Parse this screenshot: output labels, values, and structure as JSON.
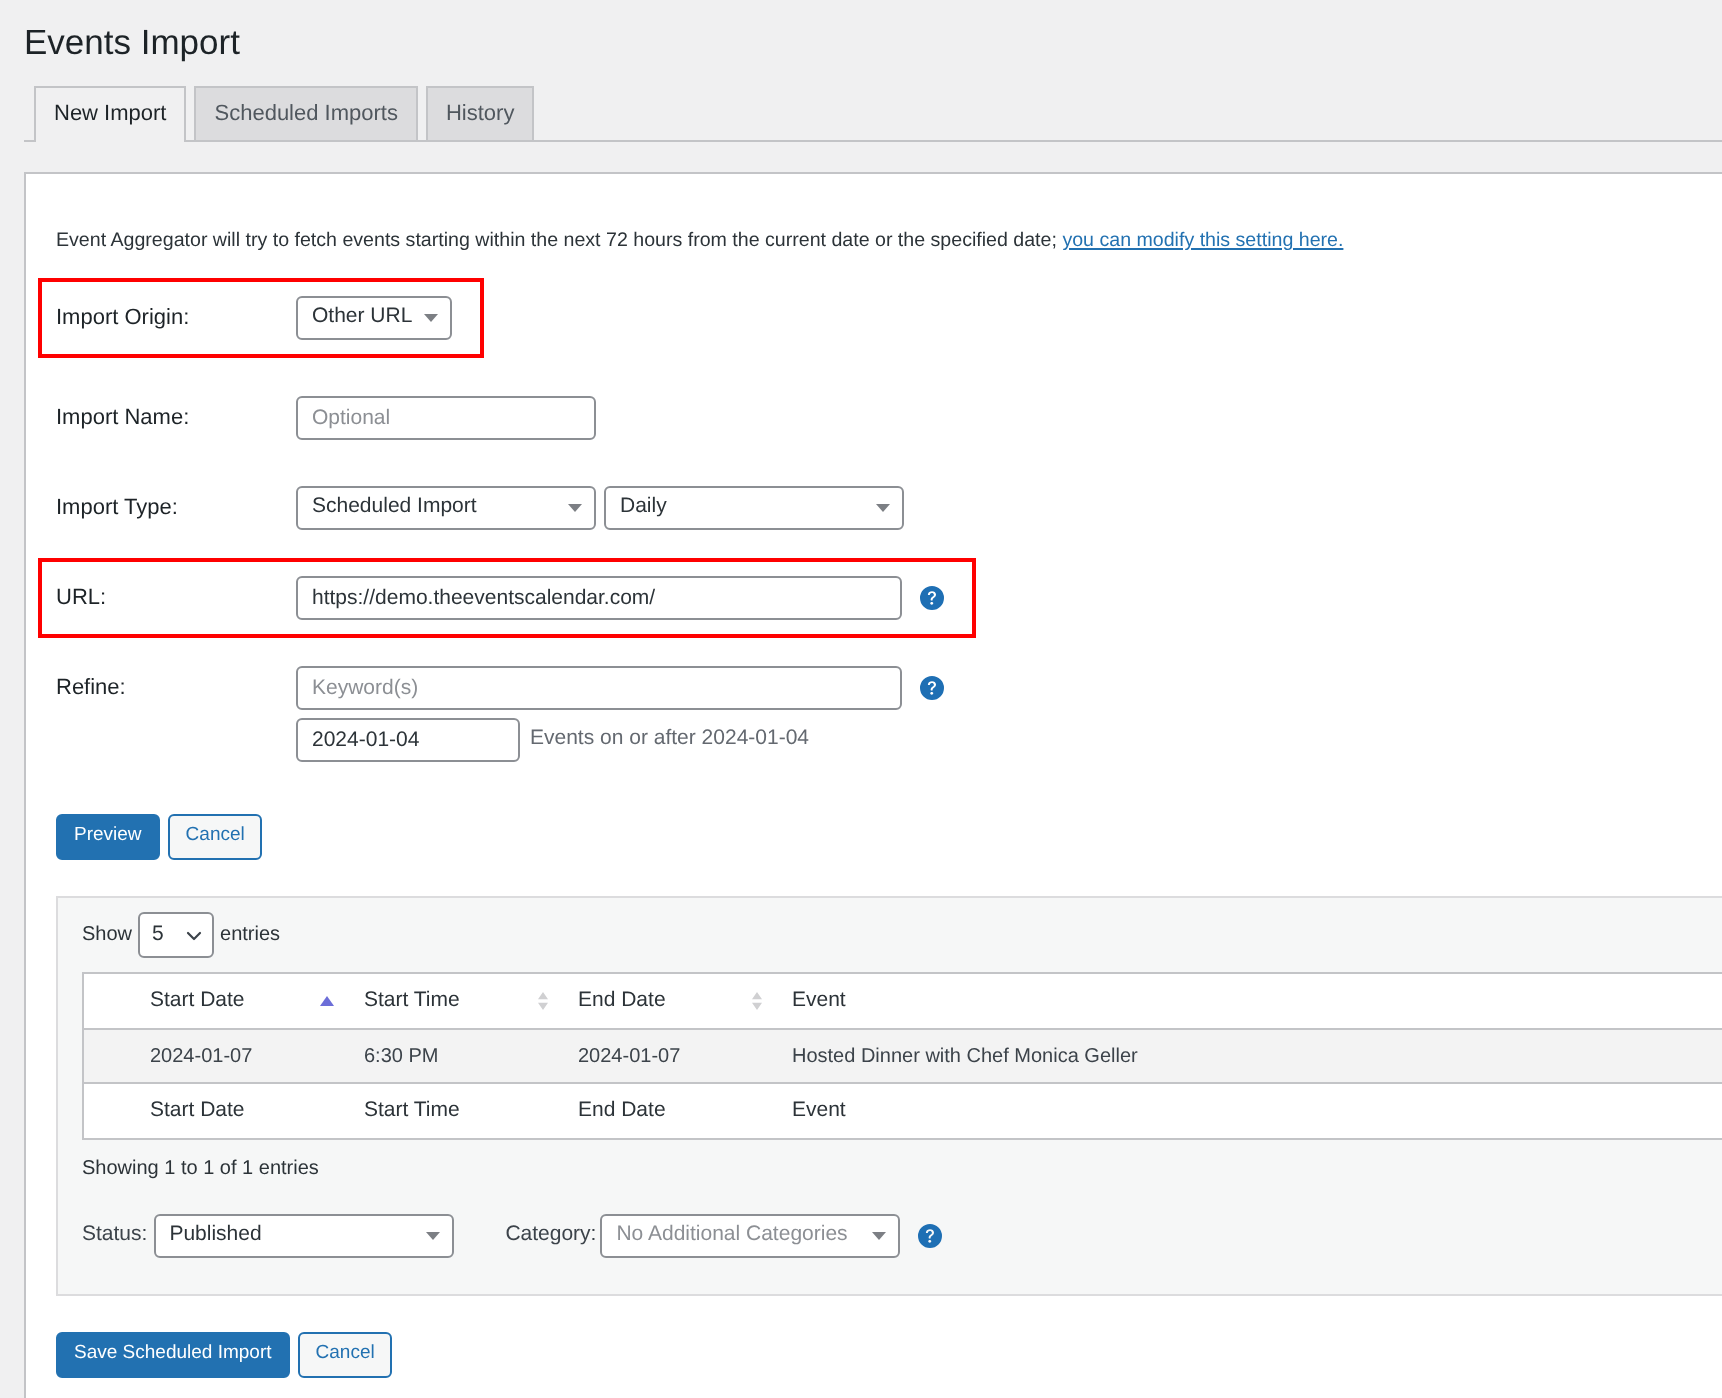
{
  "page": {
    "title": "Events Import"
  },
  "tabs": [
    {
      "label": "New Import",
      "selected": true
    },
    {
      "label": "Scheduled Imports",
      "selected": false
    },
    {
      "label": "History",
      "selected": false
    }
  ],
  "notice": {
    "text": "Event Aggregator will try to fetch events starting within the next 72 hours from the current date or the specified date;",
    "link": "you can modify this setting here."
  },
  "form": {
    "rows": [
      {
        "kind": "select",
        "label": "Import Origin:",
        "value": "Other URL",
        "highlighted": true,
        "help": false
      },
      {
        "kind": "short_input",
        "label": "Import Name:",
        "placeholder": "Optional",
        "highlighted": false,
        "help": false
      },
      {
        "kind": "select_pair",
        "label": "Import Type:",
        "values": [
          "Scheduled Import",
          "Daily"
        ],
        "highlighted": false,
        "help": false
      },
      {
        "kind": "long_input",
        "label": "URL:",
        "value": "https://demo.theeventscalendar.com/",
        "highlighted": true,
        "help": true
      },
      {
        "kind": "refine",
        "label": "Refine:",
        "placeholder": "Keyword(s)",
        "date": "2024-01-04",
        "note": "Events on or after 2024-01-04",
        "highlighted": false,
        "help": true
      }
    ]
  },
  "preview_buttons": [
    {
      "label": "Preview",
      "kind": "primary"
    },
    {
      "label": "Cancel",
      "kind": "secondary"
    }
  ],
  "preview": {
    "length_menu": {
      "before": "Show",
      "value": "5",
      "after": "entries"
    },
    "table": {
      "columns": [
        {
          "label": "Start Date",
          "sortable": true,
          "sorted_ascending": true
        },
        {
          "label": "Start Time",
          "sortable": true,
          "sorted_ascending": false
        },
        {
          "label": "End Date",
          "sortable": true,
          "sorted_ascending": false
        },
        {
          "label": "Event",
          "sortable": false,
          "sorted_ascending": false
        }
      ],
      "rows": [
        [
          "2024-01-07",
          "6:30 PM",
          "2024-01-07",
          "Hosted Dinner with Chef Monica Geller"
        ]
      ],
      "footer": [
        "Start Date",
        "Start Time",
        "End Date",
        "Event"
      ]
    },
    "info": "Showing 1 to 1 of 1 entries",
    "status": {
      "label": "Status:",
      "value": "Published"
    },
    "category": {
      "label": "Category:",
      "placeholder": "No Additional Categories",
      "help": true
    }
  },
  "save_buttons": [
    {
      "label": "Save Scheduled Import",
      "kind": "primary"
    },
    {
      "label": "Cancel",
      "kind": "secondary"
    }
  ]
}
